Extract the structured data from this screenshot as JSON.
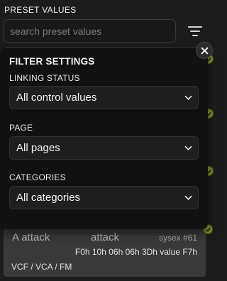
{
  "header": {
    "title": "PRESET VALUES"
  },
  "search": {
    "placeholder": "search preset values",
    "value": ""
  },
  "filter_panel": {
    "title": "FILTER SETTINGS",
    "linking_status": {
      "label": "LINKING STATUS",
      "selected": "All control values"
    },
    "page": {
      "label": "PAGE",
      "selected": "All pages"
    },
    "categories": {
      "label": "CATEGORIES",
      "selected": "All categories"
    }
  },
  "preset": {
    "name": "A attack",
    "parameter": "attack",
    "sysex_label": "sysex #61",
    "bytes": "F0h 10h 06h 06h 3Dh value F7h",
    "tags": "VCF / VCA / FM"
  },
  "colors": {
    "accent_check": "#7b8d2e",
    "panel_bg": "#111111",
    "card_bg": "#3a3a3a"
  }
}
